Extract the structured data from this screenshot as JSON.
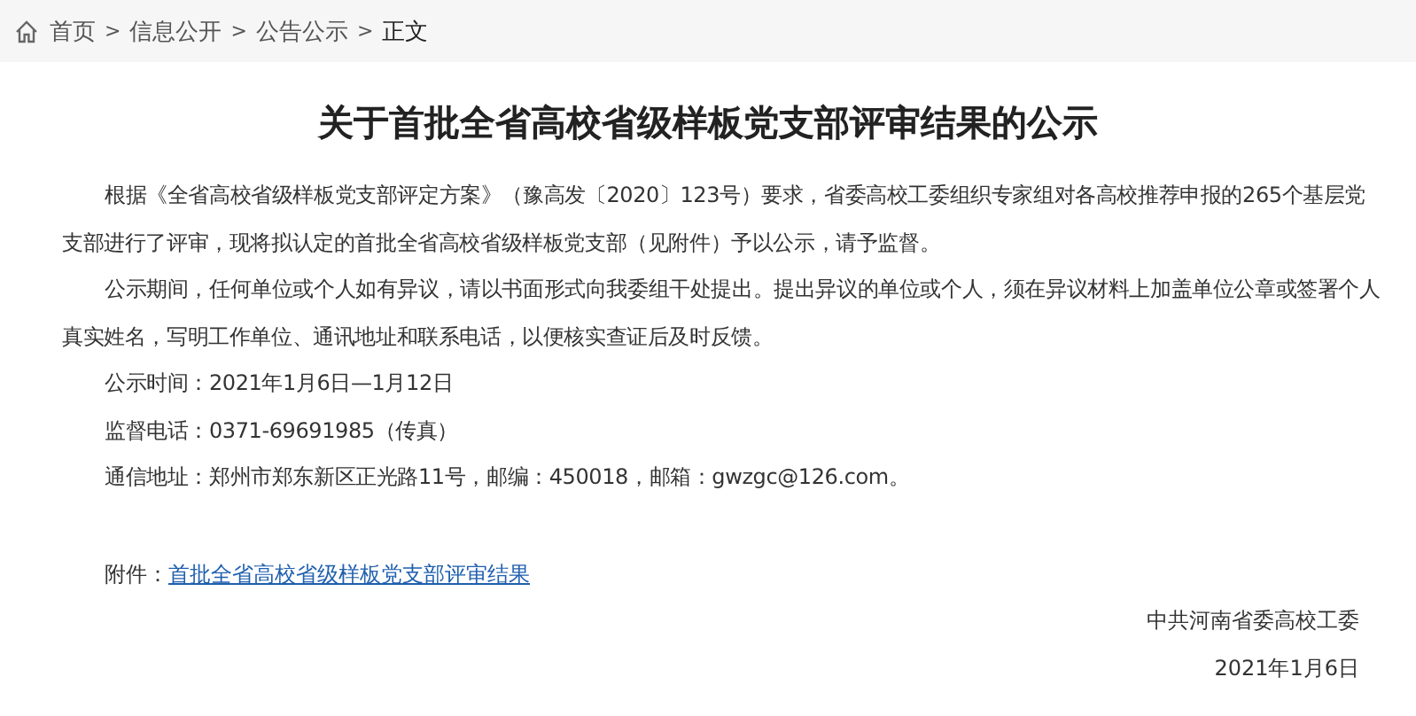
{
  "breadcrumb": [
    {
      "label": "首页",
      "current": false
    },
    {
      "label": "信息公开",
      "current": false
    },
    {
      "label": "公告公示",
      "current": false
    },
    {
      "label": "正文",
      "current": true
    }
  ],
  "breadcrumb_separator": ">",
  "title": "关于首批全省高校省级样板党支部评审结果的公示",
  "paragraphs": [
    "根据《全省高校省级样板党支部评定方案》（豫高发〔2020〕123号）要求，省委高校工委组织专家组对各高校推荐申报的265个基层党支部进行了评审，现将拟认定的首批全省高校省级样板党支部（见附件）予以公示，请予监督。",
    "公示期间，任何单位或个人如有异议，请以书面形式向我委组干处提出。提出异议的单位或个人，须在异议材料上加盖单位公章或签署个人真实姓名，写明工作单位、通讯地址和联系电话，以便核实查证后及时反馈。",
    "公示时间：2021年1月6日—1月12日",
    "监督电话：0371-69691985（传真）",
    "通信地址：郑州市郑东新区正光路11号，邮编：450018，邮箱：gwzgc@126.com。"
  ],
  "attachment": {
    "label": "附件：",
    "link": "首批全省高校省级样板党支部评审结果"
  },
  "signature": "中共河南省委高校工委",
  "date": "2021年1月6日"
}
